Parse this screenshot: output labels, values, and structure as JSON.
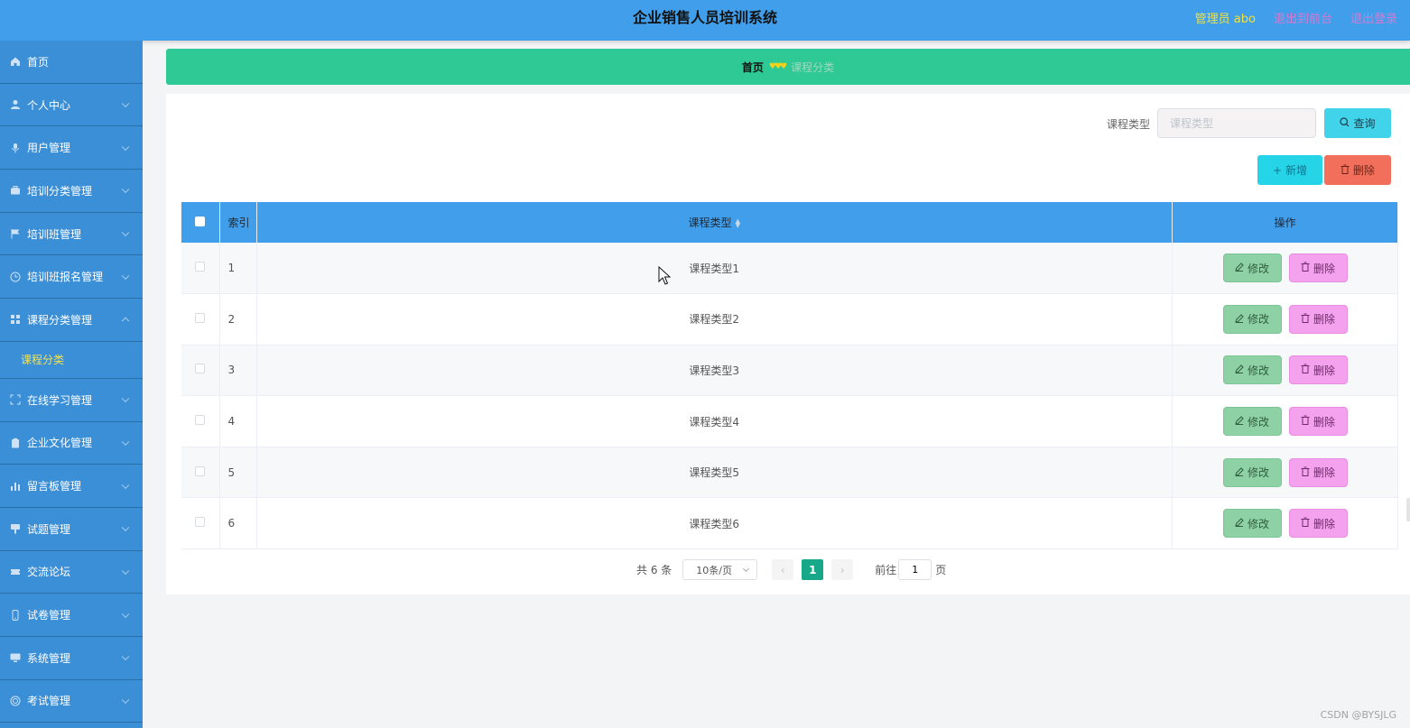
{
  "header": {
    "title": "企业销售人员培训系统",
    "admin_label": "管理员 abo",
    "exit_front": "退出到前台",
    "logout": "退出登录"
  },
  "sidebar": {
    "items": [
      {
        "label": "首页",
        "icon": "home-icon"
      },
      {
        "label": "个人中心",
        "icon": "user-icon"
      },
      {
        "label": "用户管理",
        "icon": "mic-icon"
      },
      {
        "label": "培训分类管理",
        "icon": "briefcase-icon"
      },
      {
        "label": "培训班管理",
        "icon": "flag-icon"
      },
      {
        "label": "培训班报名管理",
        "icon": "clock-icon"
      },
      {
        "label": "课程分类管理",
        "icon": "grid-icon",
        "expanded": true
      },
      {
        "label": "在线学习管理",
        "icon": "frame-icon"
      },
      {
        "label": "企业文化管理",
        "icon": "clipboard-icon"
      },
      {
        "label": "留言板管理",
        "icon": "bar-chart-icon"
      },
      {
        "label": "试题管理",
        "icon": "stamp-icon"
      },
      {
        "label": "交流论坛",
        "icon": "ticket-icon"
      },
      {
        "label": "试卷管理",
        "icon": "phone-icon"
      },
      {
        "label": "系统管理",
        "icon": "monitor-icon"
      },
      {
        "label": "考试管理",
        "icon": "circle-icon"
      }
    ],
    "submenu_active": "课程分类"
  },
  "breadcrumb": {
    "home": "首页",
    "current": "课程分类"
  },
  "search": {
    "label": "课程类型",
    "placeholder": "课程类型",
    "query_button": "查询"
  },
  "actions": {
    "add": "新增",
    "delete": "删除"
  },
  "table": {
    "headers": {
      "index": "索引",
      "type": "课程类型",
      "ops": "操作"
    },
    "rows": [
      {
        "index": "1",
        "type": "课程类型1"
      },
      {
        "index": "2",
        "type": "课程类型2"
      },
      {
        "index": "3",
        "type": "课程类型3"
      },
      {
        "index": "4",
        "type": "课程类型4"
      },
      {
        "index": "5",
        "type": "课程类型5"
      },
      {
        "index": "6",
        "type": "课程类型6"
      }
    ],
    "edit_label": "修改",
    "delete_label": "删除"
  },
  "pagination": {
    "total": "共 6 条",
    "page_size": "10条/页",
    "current_page": "1",
    "goto_prefix": "前往",
    "goto_value": "1",
    "goto_suffix": "页"
  },
  "watermark": "CSDN @BYSJLG",
  "colors": {
    "header": "#409eea",
    "sidebar": "#3b8fd6",
    "breadcrumb": "#2ec994",
    "edit": "#8ed1a4",
    "delete": "#f4a1ee"
  }
}
